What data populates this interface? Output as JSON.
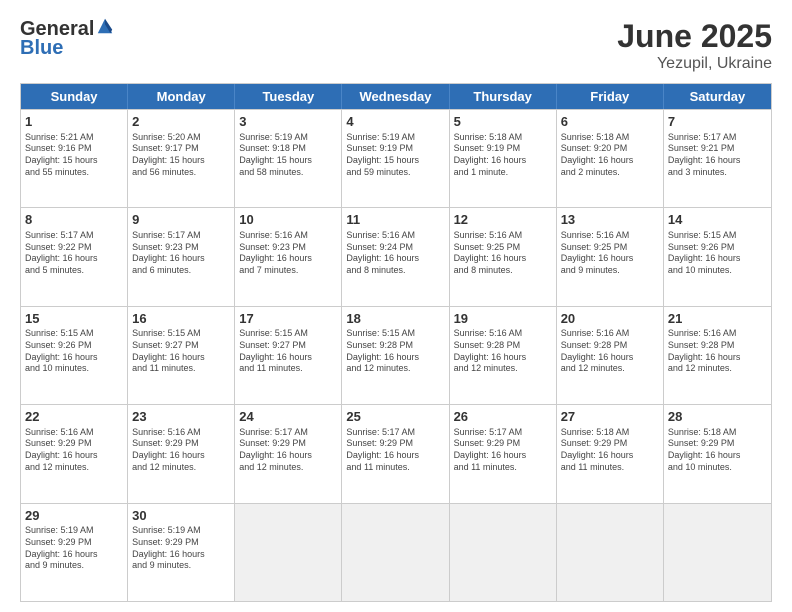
{
  "header": {
    "logo_general": "General",
    "logo_blue": "Blue",
    "title": "June 2025",
    "location": "Yezupil, Ukraine"
  },
  "days_of_week": [
    "Sunday",
    "Monday",
    "Tuesday",
    "Wednesday",
    "Thursday",
    "Friday",
    "Saturday"
  ],
  "weeks": [
    [
      {
        "day": "1",
        "info": "Sunrise: 5:21 AM\nSunset: 9:16 PM\nDaylight: 15 hours\nand 55 minutes."
      },
      {
        "day": "2",
        "info": "Sunrise: 5:20 AM\nSunset: 9:17 PM\nDaylight: 15 hours\nand 56 minutes."
      },
      {
        "day": "3",
        "info": "Sunrise: 5:19 AM\nSunset: 9:18 PM\nDaylight: 15 hours\nand 58 minutes."
      },
      {
        "day": "4",
        "info": "Sunrise: 5:19 AM\nSunset: 9:19 PM\nDaylight: 15 hours\nand 59 minutes."
      },
      {
        "day": "5",
        "info": "Sunrise: 5:18 AM\nSunset: 9:19 PM\nDaylight: 16 hours\nand 1 minute."
      },
      {
        "day": "6",
        "info": "Sunrise: 5:18 AM\nSunset: 9:20 PM\nDaylight: 16 hours\nand 2 minutes."
      },
      {
        "day": "7",
        "info": "Sunrise: 5:17 AM\nSunset: 9:21 PM\nDaylight: 16 hours\nand 3 minutes."
      }
    ],
    [
      {
        "day": "8",
        "info": "Sunrise: 5:17 AM\nSunset: 9:22 PM\nDaylight: 16 hours\nand 5 minutes."
      },
      {
        "day": "9",
        "info": "Sunrise: 5:17 AM\nSunset: 9:23 PM\nDaylight: 16 hours\nand 6 minutes."
      },
      {
        "day": "10",
        "info": "Sunrise: 5:16 AM\nSunset: 9:23 PM\nDaylight: 16 hours\nand 7 minutes."
      },
      {
        "day": "11",
        "info": "Sunrise: 5:16 AM\nSunset: 9:24 PM\nDaylight: 16 hours\nand 8 minutes."
      },
      {
        "day": "12",
        "info": "Sunrise: 5:16 AM\nSunset: 9:25 PM\nDaylight: 16 hours\nand 8 minutes."
      },
      {
        "day": "13",
        "info": "Sunrise: 5:16 AM\nSunset: 9:25 PM\nDaylight: 16 hours\nand 9 minutes."
      },
      {
        "day": "14",
        "info": "Sunrise: 5:15 AM\nSunset: 9:26 PM\nDaylight: 16 hours\nand 10 minutes."
      }
    ],
    [
      {
        "day": "15",
        "info": "Sunrise: 5:15 AM\nSunset: 9:26 PM\nDaylight: 16 hours\nand 10 minutes."
      },
      {
        "day": "16",
        "info": "Sunrise: 5:15 AM\nSunset: 9:27 PM\nDaylight: 16 hours\nand 11 minutes."
      },
      {
        "day": "17",
        "info": "Sunrise: 5:15 AM\nSunset: 9:27 PM\nDaylight: 16 hours\nand 11 minutes."
      },
      {
        "day": "18",
        "info": "Sunrise: 5:15 AM\nSunset: 9:28 PM\nDaylight: 16 hours\nand 12 minutes."
      },
      {
        "day": "19",
        "info": "Sunrise: 5:16 AM\nSunset: 9:28 PM\nDaylight: 16 hours\nand 12 minutes."
      },
      {
        "day": "20",
        "info": "Sunrise: 5:16 AM\nSunset: 9:28 PM\nDaylight: 16 hours\nand 12 minutes."
      },
      {
        "day": "21",
        "info": "Sunrise: 5:16 AM\nSunset: 9:28 PM\nDaylight: 16 hours\nand 12 minutes."
      }
    ],
    [
      {
        "day": "22",
        "info": "Sunrise: 5:16 AM\nSunset: 9:29 PM\nDaylight: 16 hours\nand 12 minutes."
      },
      {
        "day": "23",
        "info": "Sunrise: 5:16 AM\nSunset: 9:29 PM\nDaylight: 16 hours\nand 12 minutes."
      },
      {
        "day": "24",
        "info": "Sunrise: 5:17 AM\nSunset: 9:29 PM\nDaylight: 16 hours\nand 12 minutes."
      },
      {
        "day": "25",
        "info": "Sunrise: 5:17 AM\nSunset: 9:29 PM\nDaylight: 16 hours\nand 11 minutes."
      },
      {
        "day": "26",
        "info": "Sunrise: 5:17 AM\nSunset: 9:29 PM\nDaylight: 16 hours\nand 11 minutes."
      },
      {
        "day": "27",
        "info": "Sunrise: 5:18 AM\nSunset: 9:29 PM\nDaylight: 16 hours\nand 11 minutes."
      },
      {
        "day": "28",
        "info": "Sunrise: 5:18 AM\nSunset: 9:29 PM\nDaylight: 16 hours\nand 10 minutes."
      }
    ],
    [
      {
        "day": "29",
        "info": "Sunrise: 5:19 AM\nSunset: 9:29 PM\nDaylight: 16 hours\nand 9 minutes."
      },
      {
        "day": "30",
        "info": "Sunrise: 5:19 AM\nSunset: 9:29 PM\nDaylight: 16 hours\nand 9 minutes."
      },
      {
        "day": "",
        "info": ""
      },
      {
        "day": "",
        "info": ""
      },
      {
        "day": "",
        "info": ""
      },
      {
        "day": "",
        "info": ""
      },
      {
        "day": "",
        "info": ""
      }
    ]
  ]
}
